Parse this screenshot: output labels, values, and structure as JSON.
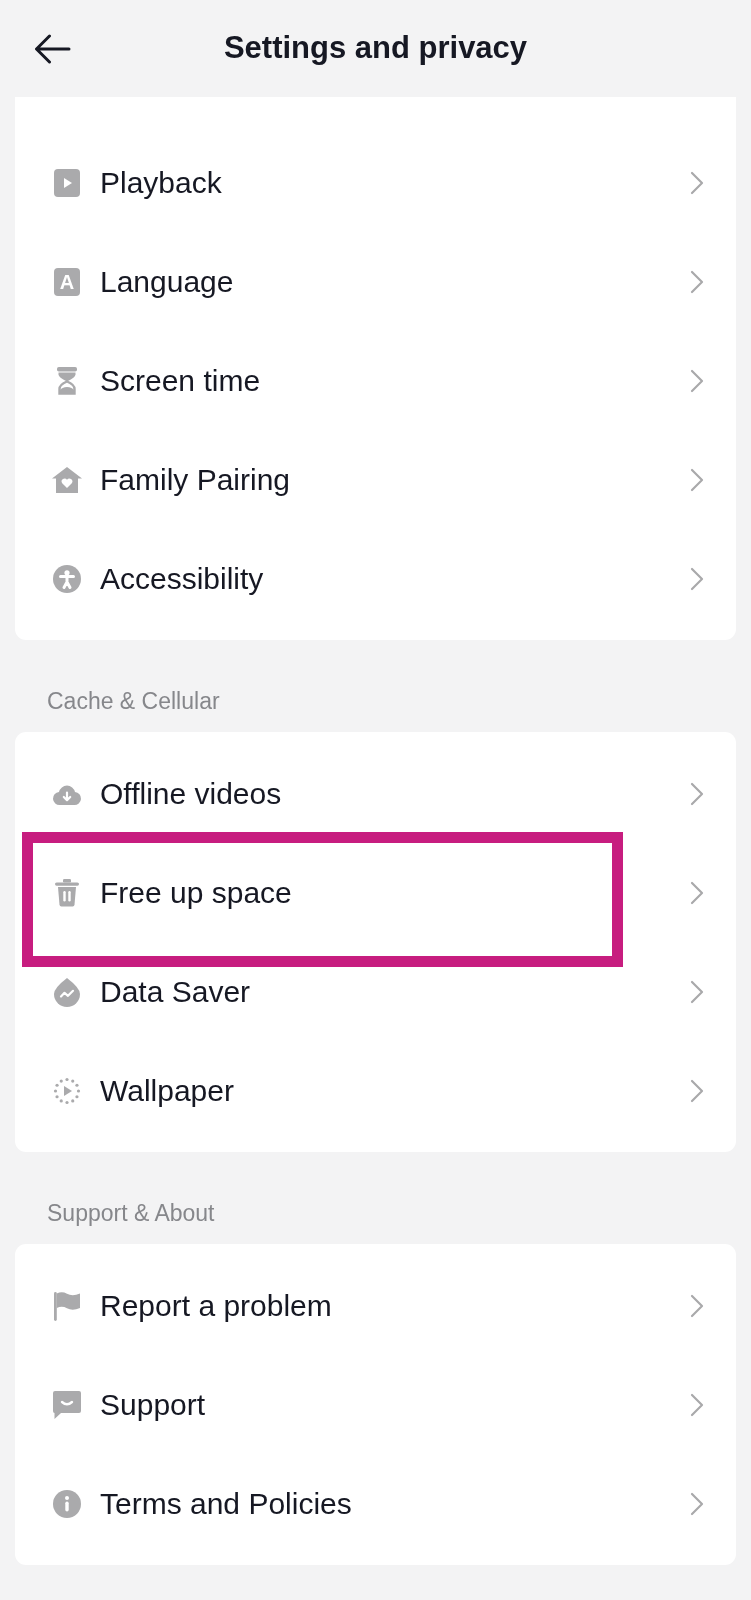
{
  "header": {
    "title": "Settings and privacy"
  },
  "sections": [
    {
      "items": [
        {
          "label": "Playback",
          "highlighted": false
        },
        {
          "label": "Language",
          "glyph": "A",
          "highlighted": false
        },
        {
          "label": "Screen time",
          "highlighted": false
        },
        {
          "label": "Family Pairing",
          "highlighted": false
        },
        {
          "label": "Accessibility",
          "highlighted": false
        }
      ]
    },
    {
      "heading": "Cache & Cellular",
      "items": [
        {
          "label": "Offline videos",
          "highlighted": false
        },
        {
          "label": "Free up space",
          "highlighted": true
        },
        {
          "label": "Data Saver",
          "highlighted": false
        },
        {
          "label": "Wallpaper",
          "highlighted": false
        }
      ]
    },
    {
      "heading": "Support & About",
      "items": [
        {
          "label": "Report a problem",
          "highlighted": false
        },
        {
          "label": "Support",
          "highlighted": false
        },
        {
          "label": "Terms and Policies",
          "highlighted": false
        }
      ]
    }
  ]
}
